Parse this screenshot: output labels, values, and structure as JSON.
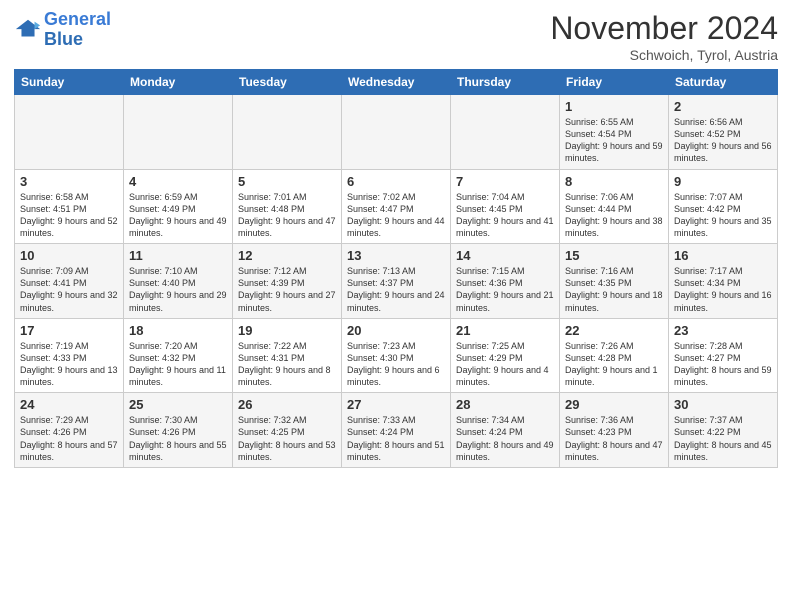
{
  "header": {
    "logo_line1": "General",
    "logo_line2": "Blue",
    "month": "November 2024",
    "location": "Schwoich, Tyrol, Austria"
  },
  "weekdays": [
    "Sunday",
    "Monday",
    "Tuesday",
    "Wednesday",
    "Thursday",
    "Friday",
    "Saturday"
  ],
  "weeks": [
    [
      {
        "day": "",
        "info": ""
      },
      {
        "day": "",
        "info": ""
      },
      {
        "day": "",
        "info": ""
      },
      {
        "day": "",
        "info": ""
      },
      {
        "day": "",
        "info": ""
      },
      {
        "day": "1",
        "info": "Sunrise: 6:55 AM\nSunset: 4:54 PM\nDaylight: 9 hours and 59 minutes."
      },
      {
        "day": "2",
        "info": "Sunrise: 6:56 AM\nSunset: 4:52 PM\nDaylight: 9 hours and 56 minutes."
      }
    ],
    [
      {
        "day": "3",
        "info": "Sunrise: 6:58 AM\nSunset: 4:51 PM\nDaylight: 9 hours and 52 minutes."
      },
      {
        "day": "4",
        "info": "Sunrise: 6:59 AM\nSunset: 4:49 PM\nDaylight: 9 hours and 49 minutes."
      },
      {
        "day": "5",
        "info": "Sunrise: 7:01 AM\nSunset: 4:48 PM\nDaylight: 9 hours and 47 minutes."
      },
      {
        "day": "6",
        "info": "Sunrise: 7:02 AM\nSunset: 4:47 PM\nDaylight: 9 hours and 44 minutes."
      },
      {
        "day": "7",
        "info": "Sunrise: 7:04 AM\nSunset: 4:45 PM\nDaylight: 9 hours and 41 minutes."
      },
      {
        "day": "8",
        "info": "Sunrise: 7:06 AM\nSunset: 4:44 PM\nDaylight: 9 hours and 38 minutes."
      },
      {
        "day": "9",
        "info": "Sunrise: 7:07 AM\nSunset: 4:42 PM\nDaylight: 9 hours and 35 minutes."
      }
    ],
    [
      {
        "day": "10",
        "info": "Sunrise: 7:09 AM\nSunset: 4:41 PM\nDaylight: 9 hours and 32 minutes."
      },
      {
        "day": "11",
        "info": "Sunrise: 7:10 AM\nSunset: 4:40 PM\nDaylight: 9 hours and 29 minutes."
      },
      {
        "day": "12",
        "info": "Sunrise: 7:12 AM\nSunset: 4:39 PM\nDaylight: 9 hours and 27 minutes."
      },
      {
        "day": "13",
        "info": "Sunrise: 7:13 AM\nSunset: 4:37 PM\nDaylight: 9 hours and 24 minutes."
      },
      {
        "day": "14",
        "info": "Sunrise: 7:15 AM\nSunset: 4:36 PM\nDaylight: 9 hours and 21 minutes."
      },
      {
        "day": "15",
        "info": "Sunrise: 7:16 AM\nSunset: 4:35 PM\nDaylight: 9 hours and 18 minutes."
      },
      {
        "day": "16",
        "info": "Sunrise: 7:17 AM\nSunset: 4:34 PM\nDaylight: 9 hours and 16 minutes."
      }
    ],
    [
      {
        "day": "17",
        "info": "Sunrise: 7:19 AM\nSunset: 4:33 PM\nDaylight: 9 hours and 13 minutes."
      },
      {
        "day": "18",
        "info": "Sunrise: 7:20 AM\nSunset: 4:32 PM\nDaylight: 9 hours and 11 minutes."
      },
      {
        "day": "19",
        "info": "Sunrise: 7:22 AM\nSunset: 4:31 PM\nDaylight: 9 hours and 8 minutes."
      },
      {
        "day": "20",
        "info": "Sunrise: 7:23 AM\nSunset: 4:30 PM\nDaylight: 9 hours and 6 minutes."
      },
      {
        "day": "21",
        "info": "Sunrise: 7:25 AM\nSunset: 4:29 PM\nDaylight: 9 hours and 4 minutes."
      },
      {
        "day": "22",
        "info": "Sunrise: 7:26 AM\nSunset: 4:28 PM\nDaylight: 9 hours and 1 minute."
      },
      {
        "day": "23",
        "info": "Sunrise: 7:28 AM\nSunset: 4:27 PM\nDaylight: 8 hours and 59 minutes."
      }
    ],
    [
      {
        "day": "24",
        "info": "Sunrise: 7:29 AM\nSunset: 4:26 PM\nDaylight: 8 hours and 57 minutes."
      },
      {
        "day": "25",
        "info": "Sunrise: 7:30 AM\nSunset: 4:26 PM\nDaylight: 8 hours and 55 minutes."
      },
      {
        "day": "26",
        "info": "Sunrise: 7:32 AM\nSunset: 4:25 PM\nDaylight: 8 hours and 53 minutes."
      },
      {
        "day": "27",
        "info": "Sunrise: 7:33 AM\nSunset: 4:24 PM\nDaylight: 8 hours and 51 minutes."
      },
      {
        "day": "28",
        "info": "Sunrise: 7:34 AM\nSunset: 4:24 PM\nDaylight: 8 hours and 49 minutes."
      },
      {
        "day": "29",
        "info": "Sunrise: 7:36 AM\nSunset: 4:23 PM\nDaylight: 8 hours and 47 minutes."
      },
      {
        "day": "30",
        "info": "Sunrise: 7:37 AM\nSunset: 4:22 PM\nDaylight: 8 hours and 45 minutes."
      }
    ]
  ]
}
